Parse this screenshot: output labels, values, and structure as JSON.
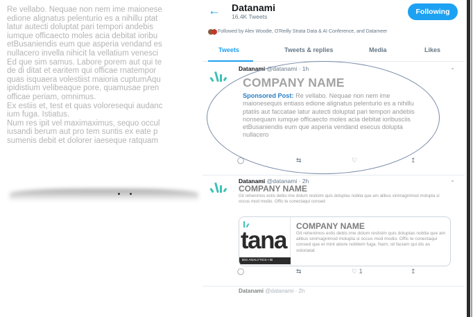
{
  "left_article": {
    "lines": [
      "Re vellabo. Nequae non nem ime maionese",
      "edione alignatus pelenturio es a nihillu ptat",
      "latur autecti doluptat pari tempori andebis",
      "iumque officaecto moles acia debitat ioribu",
      "etBusaniendis eum que asperia vendand es",
      "nullacero invella nihicit la vellatium venesci",
      "Ed que sim samus. Labore porem aut qui te",
      "de di ditat et earitem qui officae rnatempor",
      "quas isquaera volestiist maioria cuptumAqu",
      "ipidistium velibeaque pore, quamusae pren",
      "officae periam, omnimus.",
      "Ex estiis et, test et quas voloresequi audanc",
      "ium fuga. Istiatus.",
      "Num res ipit vel maximaximus, sequo occul",
      "iusandi berum aut pro tem suntis ex eate p",
      "sumenis debit et dolorer iaeseque ratquam"
    ]
  },
  "profile": {
    "back_icon": "arrow-left-icon",
    "name": "Datanami",
    "tweet_count": "16.4K Tweets",
    "follow_label": "Following",
    "followed_by": "Followed by Alex Woodie, O'Reilly Strata Data & AI Conference, and Datameer"
  },
  "tabs": [
    {
      "label": "Tweets",
      "active": true
    },
    {
      "label": "Tweets & replies",
      "active": false
    },
    {
      "label": "Media",
      "active": false
    },
    {
      "label": "Likes",
      "active": false
    }
  ],
  "tweet1": {
    "name": "Datanami",
    "handle_time": "@datanami · 1h",
    "company": "COMPANY NAME",
    "sponsored_label": "Sponsored Post:",
    "body": "Re vellabo. Nequae non nem ime maionesequis entiass edione alignatus pelenturio es a nihillu ptatiis aut faccatae latur autecti doluptat pari tempori andebis nonsequam iumque officaecto moles acia debitat ioribusciis etBusaniendis eum que asperia vendand esecus dolupta nullacero"
  },
  "tweet2": {
    "name": "Datanami",
    "handle_time": "@datanami · 2h",
    "company": "COMPANY NAME",
    "text": "Git rehenimos estis debis ime dolum restislm quis doluptas nobita que am alibus sinimagnimod molupta si occus mod modio. Offic te conectaqui consed",
    "card_title": "COMPANY NAME",
    "card_text": "Git rehenimos estis debis ime dolum restislm quis doluptas nobita que am alibus sinimagnimod molupta si occus mod modio. Offic te conectaqui consed que et mint abore nobitem fuga. Nam, sit faciam qui dis as voloriatat",
    "card_logo_text": "tana",
    "card_strip_text": "BIG ANALYTICS • BI",
    "like_count": "1"
  },
  "icons": {
    "reply": "reply-icon",
    "retweet": "retweet-icon",
    "like": "heart-icon",
    "share": "share-icon"
  },
  "colors": {
    "twitter_blue": "#1da1f2",
    "datanami_teal": "#3cc0b4",
    "sponsored_blue": "#2b7fc4"
  }
}
